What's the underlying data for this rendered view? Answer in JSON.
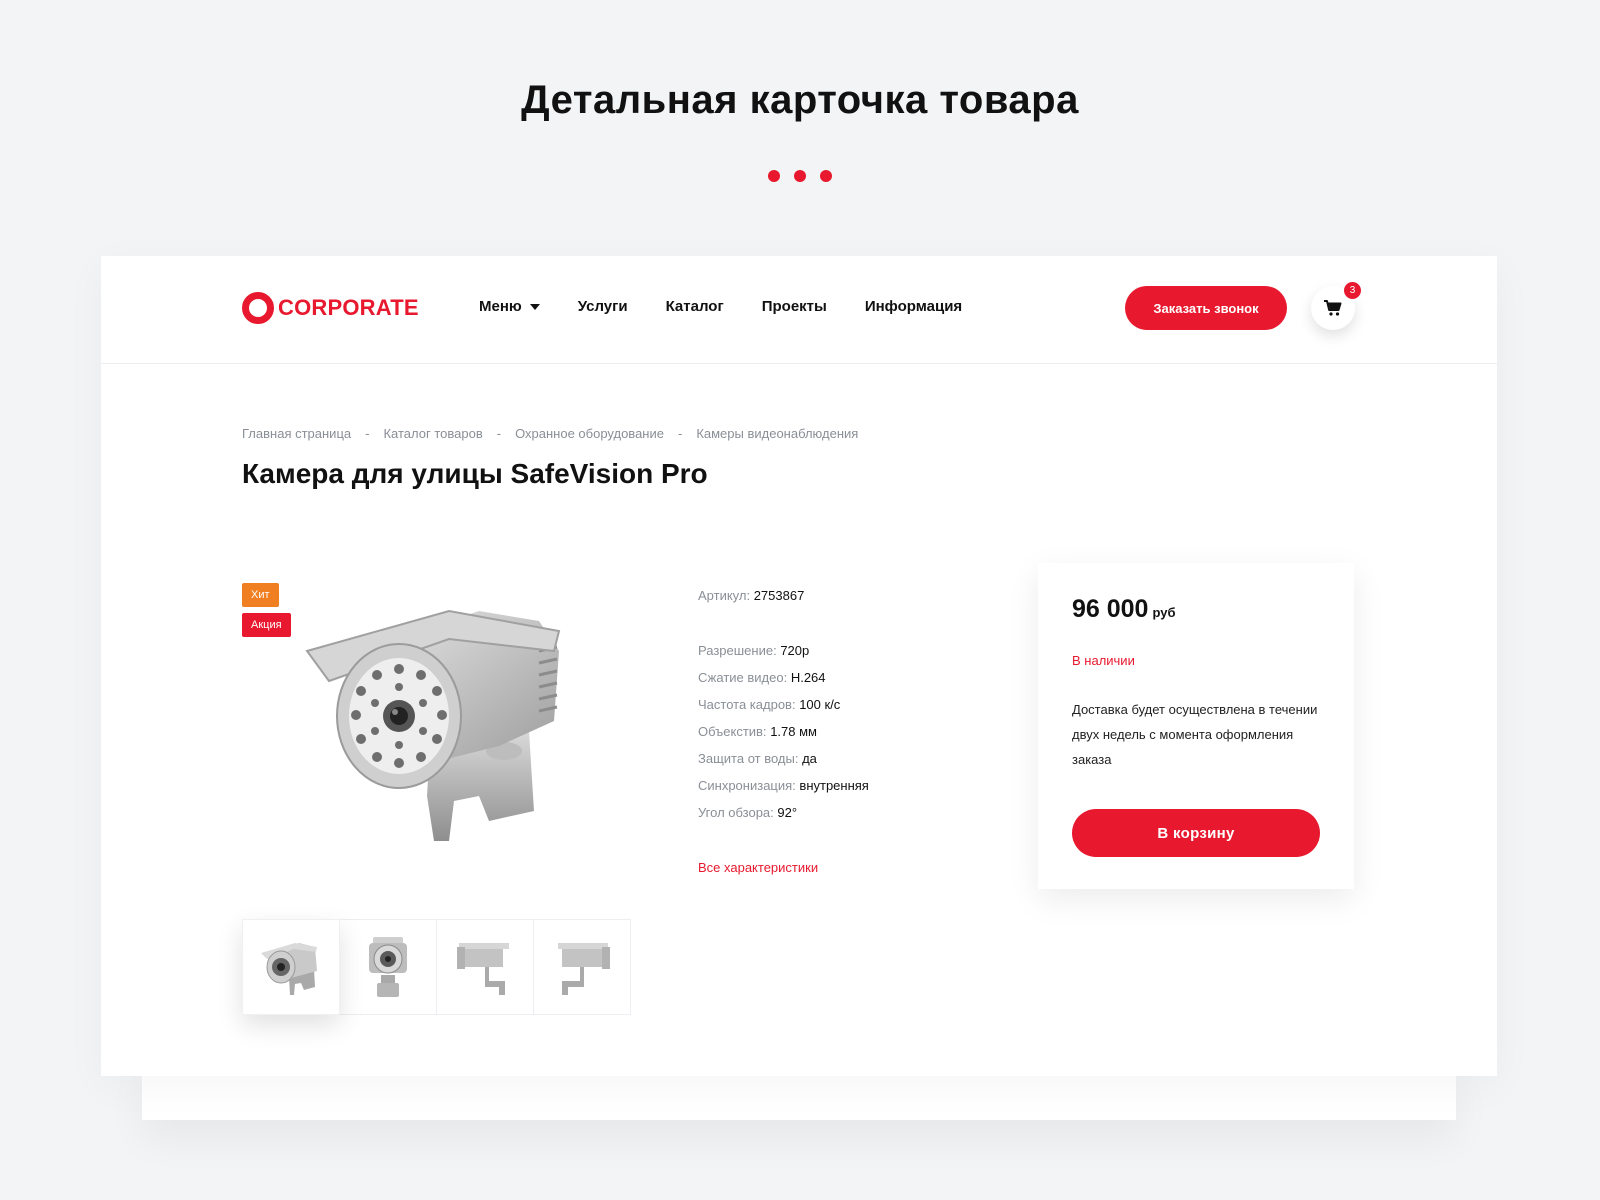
{
  "showcase": {
    "title": "Детальная карточка товара"
  },
  "header": {
    "logo_text": "CORPORATE",
    "nav": [
      {
        "label": "Меню",
        "has_dropdown": true
      },
      {
        "label": "Услуги"
      },
      {
        "label": "Каталог"
      },
      {
        "label": "Проекты"
      },
      {
        "label": "Информация"
      }
    ],
    "callback_label": "Заказать звонок",
    "cart_count": "3"
  },
  "breadcrumb": [
    "Главная страница",
    "Каталог товаров",
    "Охранное оборудование",
    "Камеры видеонаблюдения"
  ],
  "breadcrumb_sep": "-",
  "product": {
    "title": "Камера для улицы SafeVision Pro",
    "badges": {
      "hit": "Хит",
      "sale": "Акция"
    },
    "sku_label": "Артикул:",
    "sku": "2753867",
    "specs": [
      {
        "label": "Разрешение:",
        "value": "720p"
      },
      {
        "label": "Сжатие видео:",
        "value": "H.264"
      },
      {
        "label": "Частота кадров:",
        "value": "100 к/с"
      },
      {
        "label": "Объекстив:",
        "value": "1.78 мм"
      },
      {
        "label": "Защита от воды:",
        "value": "да"
      },
      {
        "label": "Синхронизация:",
        "value": "внутренняя"
      },
      {
        "label": "Угол обзора:",
        "value": "92°"
      }
    ],
    "all_specs_label": "Все характеристики"
  },
  "price_card": {
    "price": "96 000",
    "currency": "руб",
    "stock": "В наличии",
    "delivery": "Доставка будет осуществлена в течении двух недель с момента оформления заказа",
    "add_to_cart": "В корзину"
  },
  "colors": {
    "accent": "#e8192e",
    "hit_badge": "#f07f22",
    "background": "#f3f4f6"
  }
}
